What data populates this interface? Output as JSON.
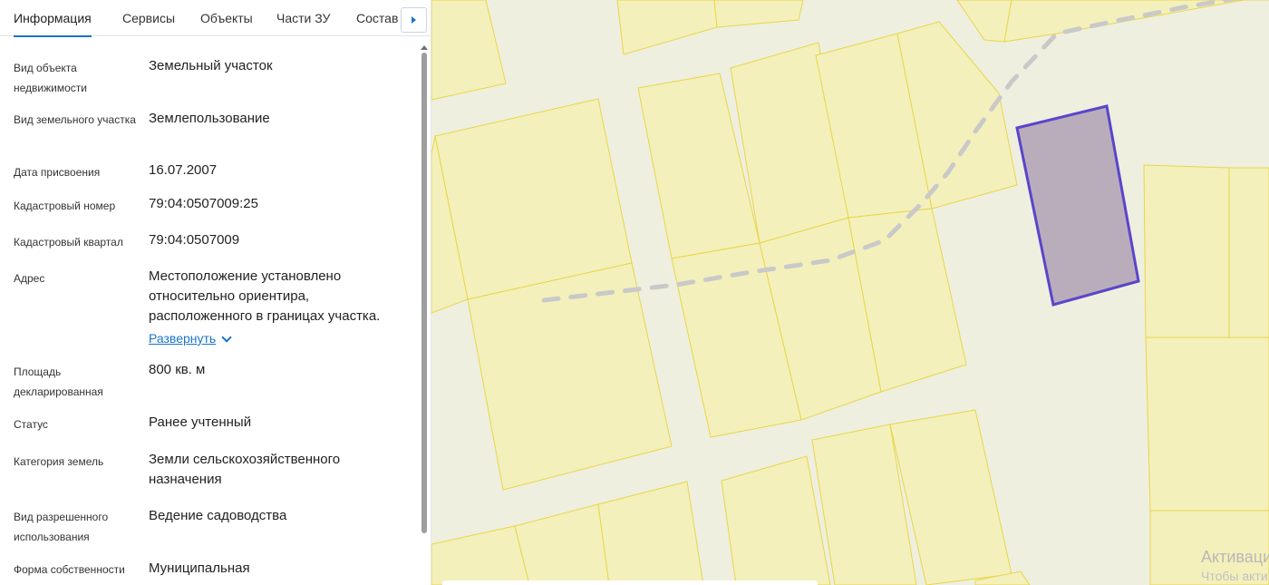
{
  "tabs": [
    "Информация",
    "Сервисы",
    "Объекты",
    "Части ЗУ",
    "Состав"
  ],
  "rows": [
    {
      "label": "Вид объекта недвижимости",
      "value": "Земельный участок"
    },
    {
      "label": "Вид земельного участка",
      "value": "Землепользование"
    },
    {
      "label": "Дата присвоения",
      "value": "16.07.2007"
    },
    {
      "label": "Кадастровый номер",
      "value": "79:04:0507009:25"
    },
    {
      "label": "Кадастровый квартал",
      "value": "79:04:0507009"
    },
    {
      "label": "Адрес",
      "value": "Местоположение установлено относительно ориентира, расположенного в границах участка."
    },
    {
      "label": "Площадь декларированная",
      "value": "800 кв. м"
    },
    {
      "label": "Статус",
      "value": "Ранее учтенный"
    },
    {
      "label": "Категория земель",
      "value": "Земли сельскохозяйственного назначения"
    },
    {
      "label": "Вид разрешенного использования",
      "value": "Ведение садоводства"
    },
    {
      "label": "Форма собственности",
      "value": "Муниципальная"
    }
  ],
  "address_expand_label": "Развернуть",
  "watermark": {
    "line1": "Активаци",
    "line2": "Чтобы акти"
  },
  "colors": {
    "accent": "#1a73c9",
    "map_background": "#efefdf",
    "parcel_fill": "#f4f0bb",
    "parcel_stroke": "#e8d64a",
    "selected_fill": "#b9adbb",
    "selected_stroke": "#5a45cc",
    "road_dash": "#c9c9c9"
  }
}
